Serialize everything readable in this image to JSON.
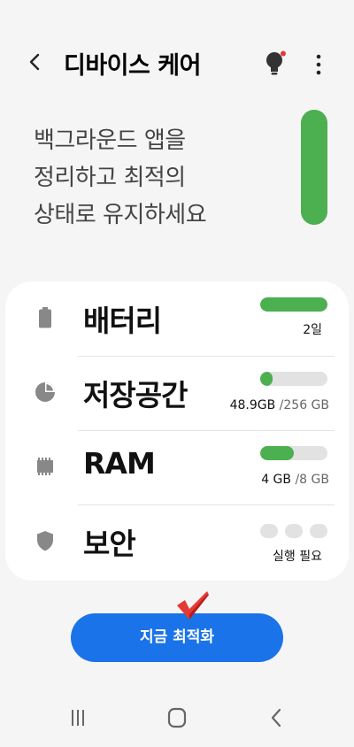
{
  "header": {
    "title": "디바이스 케어"
  },
  "hero": {
    "lines": [
      "백그라운드 앱을",
      "정리하고 최적의",
      "상태로 유지하세요"
    ],
    "level": 1.0
  },
  "items": [
    {
      "label": "배터리",
      "icon": "battery-icon",
      "progress": 1.0,
      "value": "2일"
    },
    {
      "label": "저장공간",
      "icon": "storage-pie-icon",
      "progress": 0.19,
      "value": "48.9GB",
      "total": "/256 GB"
    },
    {
      "label": "RAM",
      "icon": "memory-chip-icon",
      "progress": 0.5,
      "value": "4 GB",
      "total": "/8 GB"
    },
    {
      "label": "보안",
      "icon": "shield-icon",
      "value": "실행 필요"
    }
  ],
  "button": {
    "label": "지금 최적화"
  },
  "colors": {
    "accent": "#1a73e8",
    "good": "#4caf50",
    "track": "#e2e2e2",
    "notification": "#e53935",
    "check": "#e53935"
  }
}
